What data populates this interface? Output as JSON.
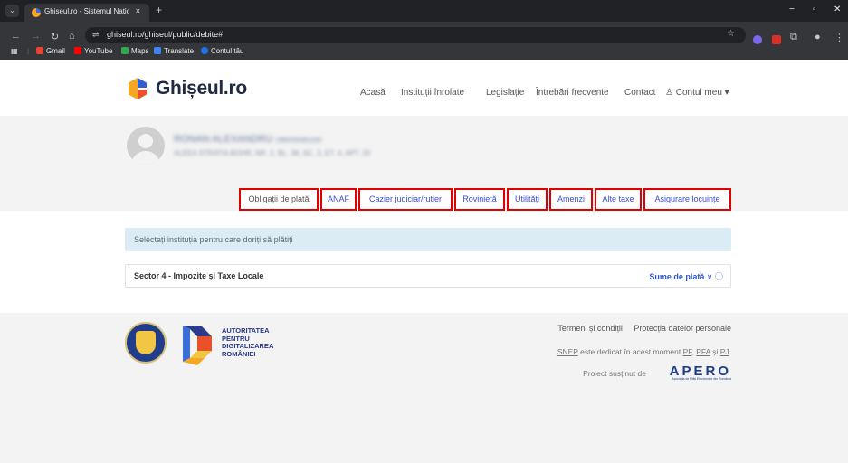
{
  "browser": {
    "tab_title": "Ghiseul.ro - Sistemul National E",
    "tab_close": "×",
    "new_tab": "+",
    "url": "ghiseul.ro/ghiseul/public/debite#",
    "bookmarks": [
      {
        "label": "Gmail",
        "color": "#ea4335"
      },
      {
        "label": "YouTube",
        "color": "#ff0000"
      },
      {
        "label": "Maps",
        "color": "#34a853"
      },
      {
        "label": "Translate",
        "color": "#4285f4"
      },
      {
        "label": "Contul tău",
        "color": "#1a73e8"
      }
    ],
    "controls": {
      "minimize": "−",
      "maximize": "▫",
      "close": "✕"
    }
  },
  "header": {
    "logo_text": "Ghișeul.ro",
    "nav": [
      "Acasă",
      "Instituții înrolate",
      "Legislație",
      "Întrebări frecvente",
      "Contact"
    ],
    "account": "Contul meu"
  },
  "profile": {
    "name_blurred": "RONAN ALEXANDRU",
    "id_blurred": "1960330461234",
    "address_blurred": "ALEEA STRATIA BOHR, NR. 2, BL. 38, SC. 3, ET. 4, APT. 20",
    "tabs": [
      "Obligații de plată",
      "ANAF",
      "Cazier judiciar/rutier",
      "Rovinietă",
      "Utilități",
      "Amenzi",
      "Alte taxe",
      "Asigurare locuințe"
    ],
    "highlight_color": "#e00000"
  },
  "main": {
    "info_text": "Selectați instituția pentru care doriți să plătiți",
    "institution": "Sector 4 - Impozite și Taxe Locale",
    "amounts_link": "Sume de plată"
  },
  "footer": {
    "adr_lines": [
      "AUTORITATEA",
      "PENTRU",
      "DIGITALIZAREA",
      "ROMÂNIEI"
    ],
    "links": [
      "Termeni și condiții",
      "Protecția datelor personale"
    ],
    "snep_prefix": "SNEP",
    "snep_text": " este dedicat în acest moment ",
    "snep_pf": "PF",
    "snep_pfa": "PFA",
    "snep_and": " și ",
    "snep_pj": "PJ",
    "supported_by": "Proiect susținut de",
    "apero_word": "APERO",
    "apero_sub": "Asociația de Plăți Electronice din România"
  }
}
